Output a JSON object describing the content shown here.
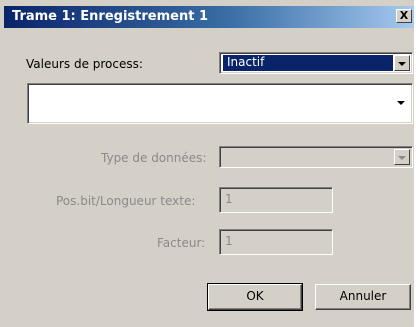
{
  "window": {
    "title": "Trame 1: Enregistrement 1",
    "close_glyph": "X"
  },
  "process": {
    "label": "Valeurs de process:",
    "selected": "Inactif"
  },
  "detail_combo": {
    "value": ""
  },
  "fields": {
    "data_type_label": "Type de données:",
    "data_type_value": "",
    "bitpos_label": "Pos.bit/Longueur texte:",
    "bitpos_value": "1",
    "factor_label": "Facteur:",
    "factor_value": "1"
  },
  "buttons": {
    "ok": "OK",
    "cancel": "Annuler"
  },
  "colors": {
    "title_active": "#0a246a",
    "dialog_face": "#d4d0c8",
    "disabled_text": "#8a8a8a"
  },
  "icons": {
    "close": "close-icon",
    "dropdown": "chevron-down-icon"
  }
}
